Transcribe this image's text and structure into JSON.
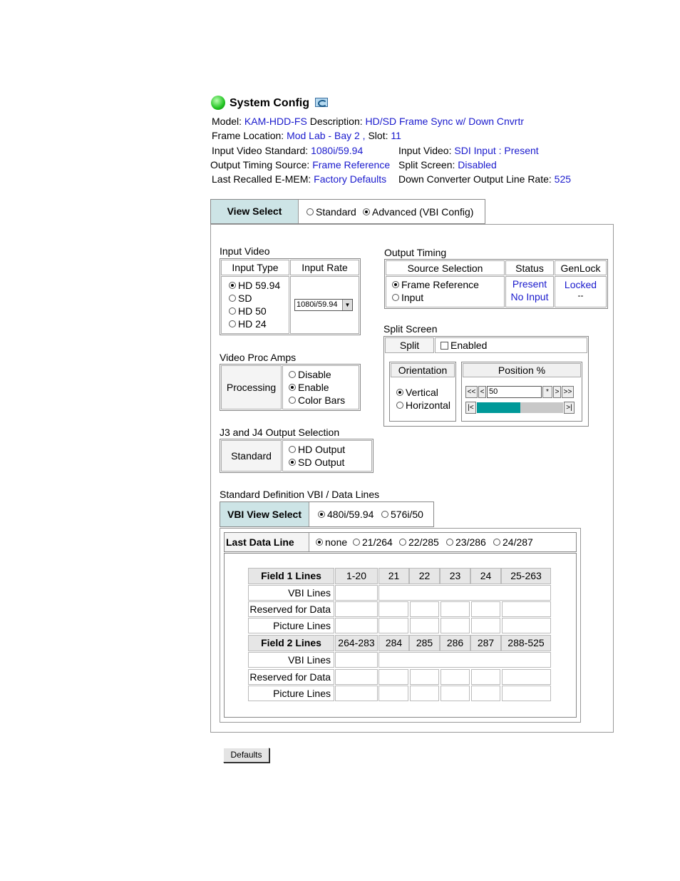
{
  "header": {
    "title": "System Config",
    "model_label": "Model:",
    "model_value": "KAM-HDD-FS",
    "description_label": "Description:",
    "description_value": "HD/SD Frame Sync w/ Down Cnvrtr",
    "frame_location_label": "Frame Location:",
    "frame_location_value": "Mod Lab - Bay 2 ,",
    "slot_label": "Slot:",
    "slot_value": "11",
    "input_video_standard_label": "Input Video Standard:",
    "input_video_standard_value": "1080i/59.94",
    "input_video_label": "Input Video:",
    "input_video_value": "SDI Input : Present",
    "output_timing_source_label": "Output Timing Source:",
    "output_timing_source_value": "Frame Reference",
    "split_screen_label": "Split Screen:",
    "split_screen_value": "Disabled",
    "last_recalled_label": "Last Recalled E-MEM:",
    "last_recalled_value": "Factory Defaults",
    "down_converter_label": "Down Converter Output Line Rate:",
    "down_converter_value": "525"
  },
  "view_select": {
    "label": "View Select",
    "standard": "Standard",
    "advanced": "Advanced (VBI Config)"
  },
  "input_video": {
    "title": "Input Video",
    "col_type": "Input Type",
    "col_rate": "Input Rate",
    "types": [
      "HD 59.94",
      "SD",
      "HD 50",
      "HD 24"
    ],
    "rate_value": "1080i/59.94"
  },
  "output_timing": {
    "title": "Output Timing",
    "col_source": "Source Selection",
    "col_status": "Status",
    "col_genlock": "GenLock",
    "frame_reference": "Frame Reference",
    "input": "Input",
    "status_present": "Present",
    "status_no_input": "No Input",
    "genlock_locked": "Locked",
    "genlock_dash": "--"
  },
  "video_proc": {
    "title": "Video Proc Amps",
    "label": "Processing",
    "disable": "Disable",
    "enable": "Enable",
    "color_bars": "Color Bars"
  },
  "split_screen": {
    "title": "Split Screen",
    "split_label": "Split",
    "enabled": "Enabled",
    "orientation": "Orientation",
    "vertical": "Vertical",
    "horizontal": "Horizontal",
    "position": "Position %",
    "position_value": "50",
    "position_fraction": 0.5,
    "btn_first": "<<",
    "btn_prev": "<",
    "btn_star": "*",
    "btn_next": ">",
    "btn_last": ">>",
    "btn_min": "|<",
    "btn_max": ">|"
  },
  "j3j4": {
    "title": "J3 and J4 Output Selection",
    "label": "Standard",
    "hd": "HD Output",
    "sd": "SD Output"
  },
  "vbi": {
    "title": "Standard Definition VBI / Data Lines",
    "view_select": "VBI View Select",
    "opt_480": "480i/59.94",
    "opt_576": "576i/50",
    "last_data_line": "Last Data Line",
    "opts": [
      "none",
      "21/264",
      "22/285",
      "23/286",
      "24/287"
    ],
    "field1": "Field 1 Lines",
    "field1_cols": [
      "1-20",
      "21",
      "22",
      "23",
      "24",
      "25-263"
    ],
    "field2": "Field 2 Lines",
    "field2_cols": [
      "264-283",
      "284",
      "285",
      "286",
      "287",
      "288-525"
    ],
    "vbi_lines": "VBI Lines",
    "reserved": "Reserved for Data",
    "picture": "Picture Lines"
  },
  "defaults_button": "Defaults",
  "colors": {
    "link": "#1a1acd",
    "fill_blue": "#0000ff",
    "teal": "#009999",
    "panel_blue": "#cde4e6"
  }
}
